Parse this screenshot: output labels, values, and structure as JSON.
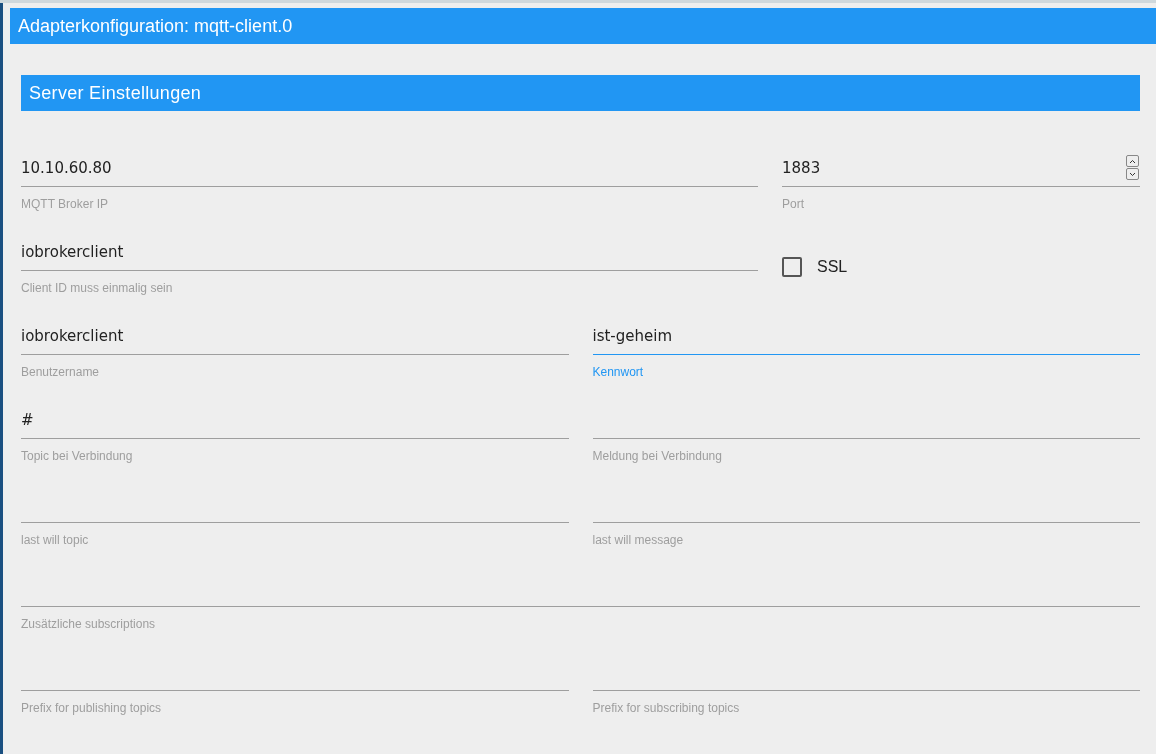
{
  "window": {
    "title": "Adapterkonfiguration: mqtt-client.0"
  },
  "section": {
    "title": "Server Einstellungen"
  },
  "rows": [
    {
      "fields": [
        {
          "kind": "text",
          "value": "10.10.60.80",
          "label": "MQTT Broker IP",
          "focused": false
        },
        {
          "kind": "number",
          "value": "1883",
          "label": "Port",
          "focused": false
        }
      ]
    },
    {
      "fields": [
        {
          "kind": "text",
          "value": "iobrokerclient",
          "label": "Client ID muss einmalig sein",
          "focused": false
        },
        {
          "kind": "checkbox",
          "label": "SSL",
          "checked": false
        }
      ]
    },
    {
      "fields": [
        {
          "kind": "text",
          "value": "iobrokerclient",
          "label": "Benutzername",
          "focused": false
        },
        {
          "kind": "text",
          "value": "ist-geheim",
          "label": "Kennwort",
          "focused": true
        }
      ]
    },
    {
      "fields": [
        {
          "kind": "text",
          "value": "#",
          "label": "Topic bei Verbindung",
          "focused": false
        },
        {
          "kind": "text",
          "label": "Meldung bei Verbindung",
          "focused": false
        }
      ]
    },
    {
      "fields": [
        {
          "kind": "text",
          "label": "last will topic",
          "focused": false
        },
        {
          "kind": "text",
          "label": "last will message",
          "focused": false
        }
      ]
    },
    {
      "fields": [
        {
          "kind": "text",
          "label": "Zusätzliche subscriptions",
          "focused": false
        }
      ]
    },
    {
      "fields": [
        {
          "kind": "text",
          "label": "Prefix for publishing topics",
          "focused": false
        },
        {
          "kind": "text",
          "label": "Prefix for subscribing topics",
          "focused": false
        }
      ]
    }
  ]
}
